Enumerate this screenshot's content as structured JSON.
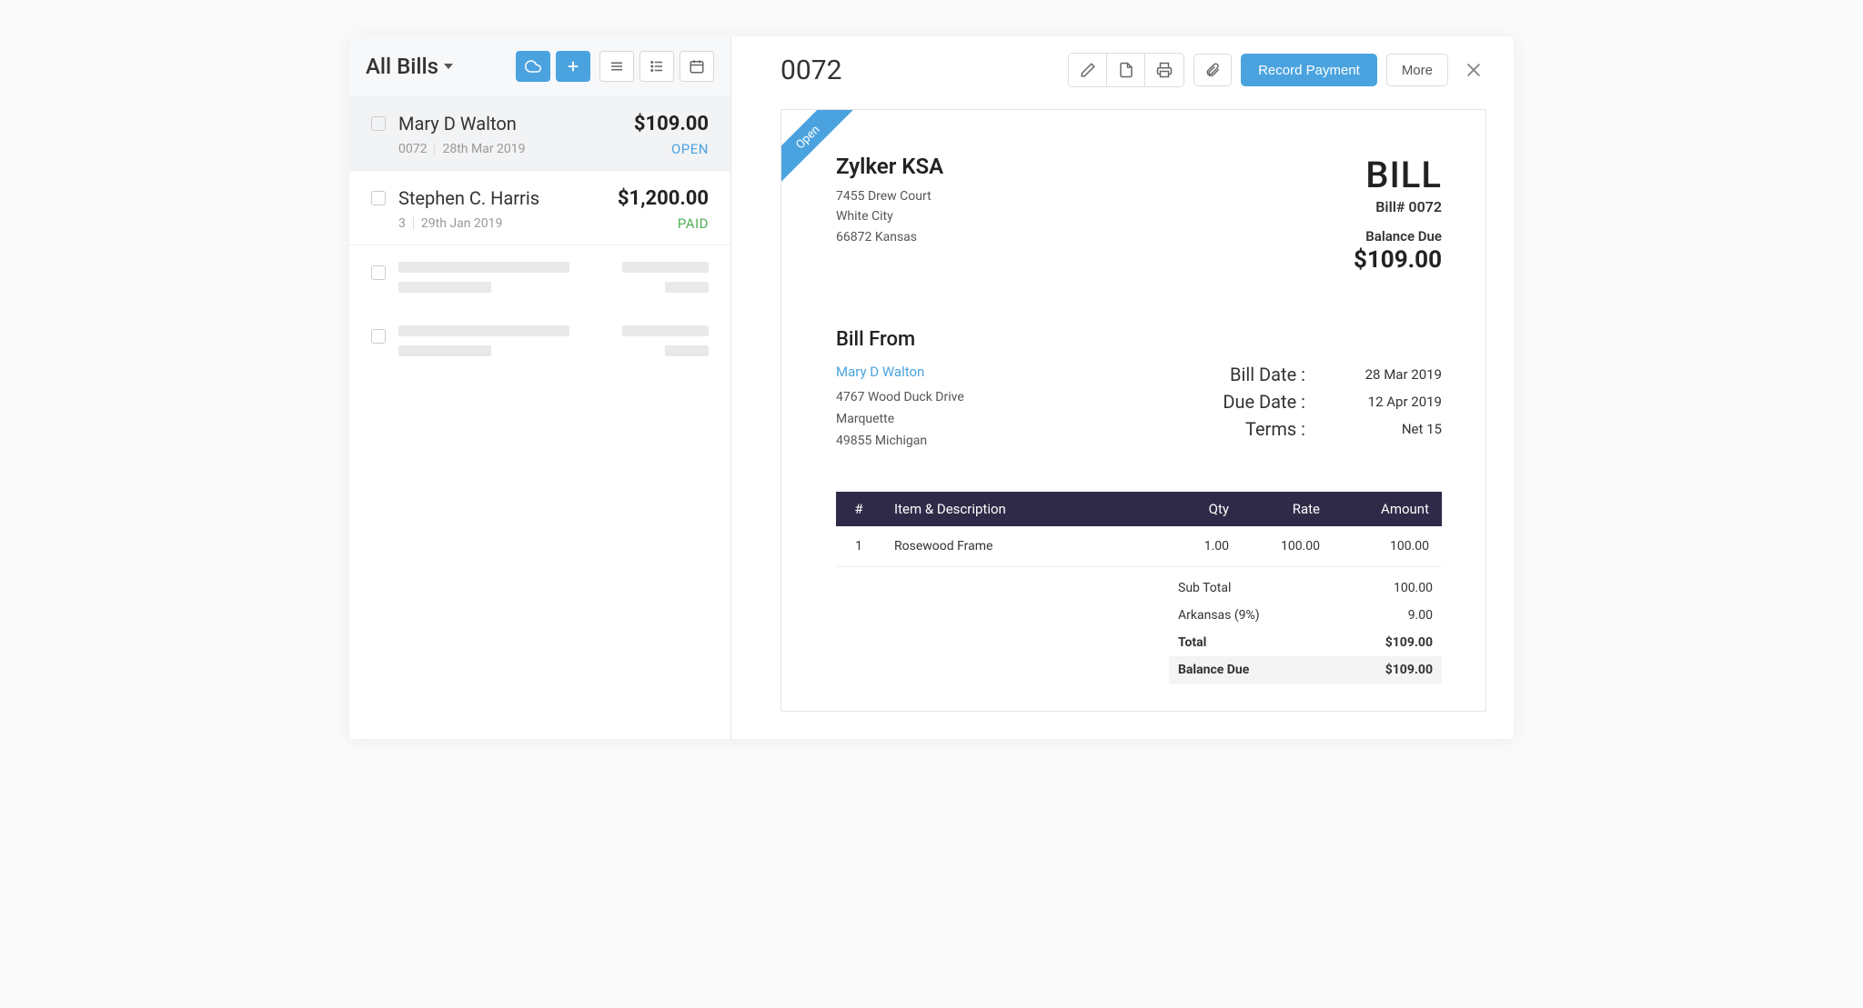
{
  "sidebar": {
    "filter_label": "All Bills"
  },
  "bills": [
    {
      "name": "Mary D Walton",
      "number": "0072",
      "date": "28th Mar 2019",
      "amount": "$109.00",
      "status": "OPEN",
      "status_class": "status-open",
      "selected": true
    },
    {
      "name": "Stephen C. Harris",
      "number": "3",
      "date": "29th Jan 2019",
      "amount": "$1,200.00",
      "status": "PAID",
      "status_class": "status-paid",
      "selected": false
    }
  ],
  "detail": {
    "title": "0072",
    "record_payment": "Record Payment",
    "more": "More"
  },
  "invoice": {
    "ribbon": "Open",
    "company_name": "Zylker KSA",
    "company_addr1": "7455 Drew Court",
    "company_addr2": "White City",
    "company_addr3": "66872 Kansas",
    "big_label": "BILL",
    "bill_no_label": "Bill# 0072",
    "balance_due_label": "Balance Due",
    "balance_due_amount": "$109.00",
    "bill_from_heading": "Bill From",
    "vendor_name": "Mary D Walton",
    "vendor_addr1": "4767 Wood Duck Drive",
    "vendor_addr2": "Marquette",
    "vendor_addr3": "49855 Michigan",
    "bill_date_label": "Bill Date :",
    "bill_date": "28 Mar 2019",
    "due_date_label": "Due Date :",
    "due_date": "12 Apr 2019",
    "terms_label": "Terms :",
    "terms": "Net 15",
    "headers": {
      "num": "#",
      "desc": "Item & Description",
      "qty": "Qty",
      "rate": "Rate",
      "amount": "Amount"
    },
    "lines": [
      {
        "num": "1",
        "desc": "Rosewood Frame",
        "qty": "1.00",
        "rate": "100.00",
        "amount": "100.00"
      }
    ],
    "totals": {
      "subtotal_label": "Sub Total",
      "subtotal": "100.00",
      "tax_label": "Arkansas (9%)",
      "tax": "9.00",
      "total_label": "Total",
      "total": "$109.00",
      "balance_label": "Balance Due",
      "balance": "$109.00"
    }
  }
}
